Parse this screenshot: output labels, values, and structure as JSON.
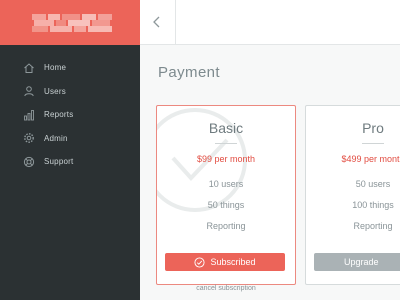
{
  "colors": {
    "brand": "#ec6459",
    "sidebar": "#2b3133",
    "backdrop": "#3d5459",
    "price": "#e24d42",
    "upgrade_button": "#aab2b5"
  },
  "sidebar": {
    "items": [
      {
        "label": "Home",
        "icon": "home-icon"
      },
      {
        "label": "Users",
        "icon": "user-icon"
      },
      {
        "label": "Reports",
        "icon": "bar-chart-icon"
      },
      {
        "label": "Admin",
        "icon": "gear-icon"
      },
      {
        "label": "Support",
        "icon": "lifebuoy-icon"
      }
    ]
  },
  "header": {
    "back_icon": "chevron-left-icon"
  },
  "main": {
    "title": "Payment"
  },
  "plans": [
    {
      "name": "Basic",
      "price": "$99 per month",
      "features": [
        "10 users",
        "50 things",
        "Reporting"
      ],
      "button": "Subscribed",
      "status_icon": "check-circle-icon"
    },
    {
      "name": "Pro",
      "price": "$499 per month",
      "features": [
        "50 users",
        "100 things",
        "Reporting"
      ],
      "button": "Upgrade"
    }
  ],
  "cancel_link": "cancel subscription"
}
